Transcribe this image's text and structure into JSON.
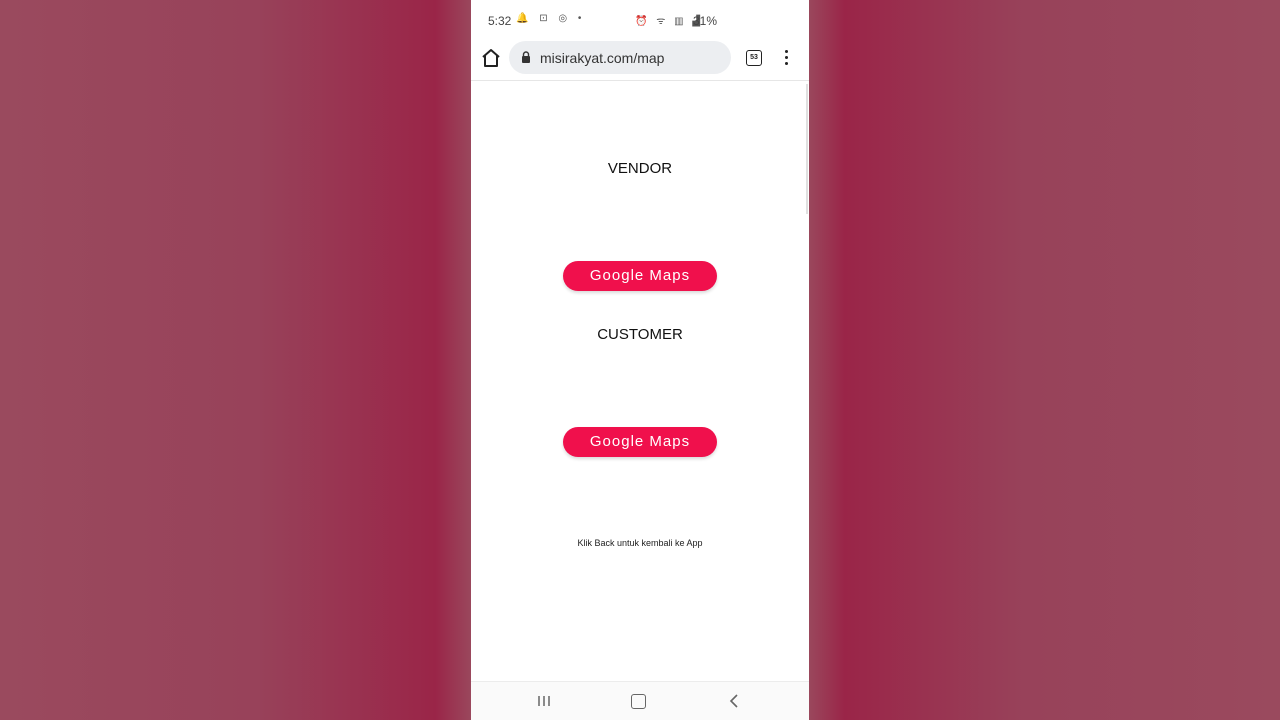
{
  "status_bar": {
    "time": "5:32",
    "battery": "31%"
  },
  "browser": {
    "url": "misirakyat.com/map",
    "tab_count": "53"
  },
  "content": {
    "vendor_heading": "VENDOR",
    "vendor_button": "Google Maps",
    "customer_heading": "CUSTOMER",
    "customer_button": "Google Maps",
    "note": "Klik Back untuk kembali ke App"
  },
  "colors": {
    "accent": "#f0104c",
    "backdrop": "#9a4a5e"
  },
  "icons": [
    "home-icon",
    "lock-icon",
    "tabs-icon",
    "more-vert-icon",
    "recents-icon",
    "nav-home-icon",
    "back-icon"
  ]
}
